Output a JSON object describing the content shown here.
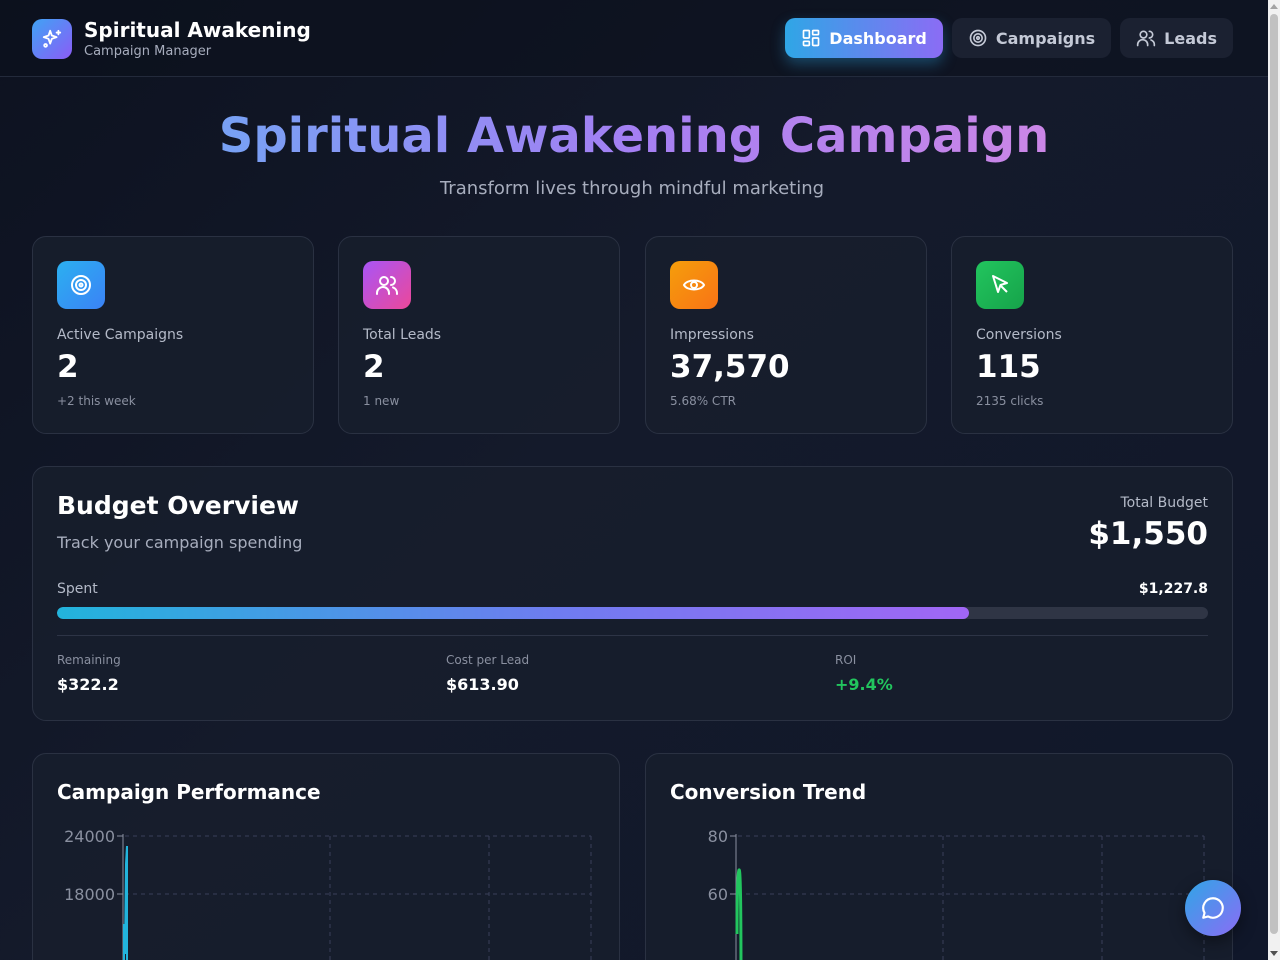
{
  "brand": {
    "title": "Spiritual Awakening",
    "subtitle": "Campaign Manager",
    "icon": "sparkles-icon"
  },
  "nav": {
    "dashboard": "Dashboard",
    "campaigns": "Campaigns",
    "leads": "Leads",
    "active": "Dashboard"
  },
  "hero": {
    "title": "Spiritual Awakening Campaign",
    "subtitle": "Transform lives through mindful marketing"
  },
  "stats": [
    {
      "label": "Active Campaigns",
      "value": "2",
      "note": "+2 this week",
      "icon": "target-icon",
      "color": "#3b9ef0"
    },
    {
      "label": "Total Leads",
      "value": "2",
      "note": "1 new",
      "icon": "users-icon",
      "color": "#c04fd6"
    },
    {
      "label": "Impressions",
      "value": "37,570",
      "note": "5.68% CTR",
      "icon": "eye-icon",
      "color": "#f27c12"
    },
    {
      "label": "Conversions",
      "value": "115",
      "note": "2135 clicks",
      "icon": "cursor-icon",
      "color": "#22c55e"
    }
  ],
  "budget": {
    "title": "Budget Overview",
    "subtitle": "Track your campaign spending",
    "total_label": "Total Budget",
    "total_value": "$1,550",
    "spent_label": "Spent",
    "spent_value": "$1,227.8",
    "spent_fraction": 0.792,
    "remaining_label": "Remaining",
    "remaining_value": "$322.2",
    "cpl_label": "Cost per Lead",
    "cpl_value": "$613.90",
    "roi_label": "ROI",
    "roi_value": "+9.4%"
  },
  "chart_data": [
    {
      "type": "line",
      "title": "Campaign Performance",
      "yticks": [
        "24000",
        "18000"
      ],
      "ylim": [
        12000,
        24000
      ],
      "grid": true
    },
    {
      "type": "line",
      "title": "Conversion Trend",
      "yticks": [
        "80",
        "60"
      ],
      "ylim": [
        40,
        80
      ],
      "grid": true,
      "line_color": "#22c55e"
    }
  ],
  "fab": {
    "icon": "chat-icon"
  }
}
